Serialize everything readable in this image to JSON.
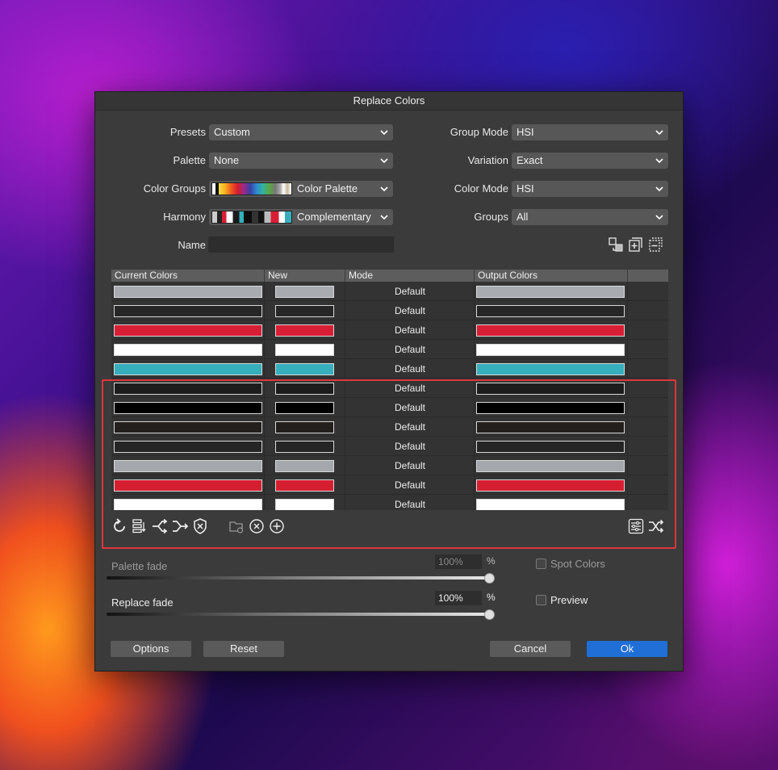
{
  "dialog": {
    "title": "Replace Colors"
  },
  "fields": {
    "presets": {
      "label": "Presets",
      "value": "Custom"
    },
    "palette": {
      "label": "Palette",
      "value": "None"
    },
    "color_groups": {
      "label": "Color Groups",
      "value": "Color Palette"
    },
    "harmony": {
      "label": "Harmony",
      "value": "Complementary"
    },
    "name": {
      "label": "Name",
      "value": ""
    },
    "group_mode": {
      "label": "Group Mode",
      "value": "HSI"
    },
    "variation": {
      "label": "Variation",
      "value": "Exact"
    },
    "color_mode": {
      "label": "Color Mode",
      "value": "HSI"
    },
    "groups": {
      "label": "Groups",
      "value": "All"
    }
  },
  "table": {
    "headers": [
      "Current Colors",
      "New",
      "Mode",
      "Output Colors"
    ],
    "rows": [
      {
        "current": "#a8acb0",
        "new": "#a8acb0",
        "mode": "Default",
        "output": "#a8acb0"
      },
      {
        "current": "#262626",
        "new": "#262626",
        "mode": "Default",
        "output": "#262626"
      },
      {
        "current": "#d81e34",
        "new": "#d81e34",
        "mode": "Default",
        "output": "#d81e34"
      },
      {
        "current": "#ffffff",
        "new": "#ffffff",
        "mode": "Default",
        "output": "#ffffff"
      },
      {
        "current": "#36aebb",
        "new": "#36aebb",
        "mode": "Default",
        "output": "#36aebb"
      },
      {
        "current": "#1c1c1c",
        "new": "#1c1c1c",
        "mode": "Default",
        "output": "#1c1c1c"
      },
      {
        "current": "#000000",
        "new": "#000000",
        "mode": "Default",
        "output": "#000000"
      },
      {
        "current": "#221f1c",
        "new": "#221f1c",
        "mode": "Default",
        "output": "#221f1c"
      },
      {
        "current": "#252525",
        "new": "#252525",
        "mode": "Default",
        "output": "#252525"
      },
      {
        "current": "#a4a8ac",
        "new": "#a4a8ac",
        "mode": "Default",
        "output": "#a4a8ac"
      },
      {
        "current": "#d51f31",
        "new": "#d51f31",
        "mode": "Default",
        "output": "#d51f31"
      },
      {
        "current": "#ffffff",
        "new": "#ffffff",
        "mode": "Default",
        "output": "#ffffff"
      }
    ]
  },
  "palette_fade": {
    "label": "Palette fade",
    "value": "100%",
    "unit": "%",
    "level": 1.0
  },
  "replace_fade": {
    "label": "Replace fade",
    "value": "100%",
    "unit": "%",
    "level": 1.0
  },
  "checkboxes": {
    "spot_colors": {
      "label": "Spot Colors",
      "checked": false
    },
    "preview": {
      "label": "Preview",
      "checked": false
    }
  },
  "buttons": {
    "options": "Options",
    "reset": "Reset",
    "cancel": "Cancel",
    "ok": "Ok"
  },
  "colors": {
    "accent": "#1f6fd6",
    "highlight": "#e0353e"
  }
}
